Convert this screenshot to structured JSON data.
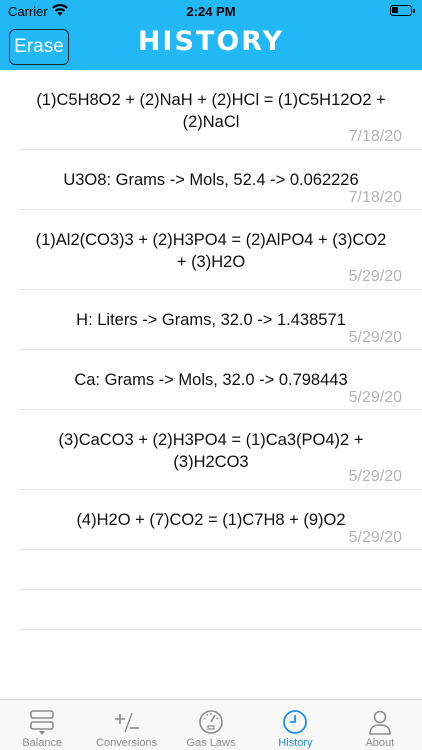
{
  "status_bar": {
    "carrier": "Carrier",
    "time": "2:24 PM"
  },
  "header": {
    "erase_label": "Erase",
    "title": "HISTORY"
  },
  "history": [
    {
      "line1": "(1)C5H8O2 + (2)NaH + (2)HCl = (1)C5H12O2 +",
      "line2": "(2)NaCl",
      "date": "7/18/20"
    },
    {
      "line1": "U3O8: Grams -> Mols, 52.4 -> 0.062226",
      "line2": "",
      "date": "7/18/20"
    },
    {
      "line1": "(1)Al2(CO3)3 + (2)H3PO4 = (2)AlPO4 + (3)CO2",
      "line2": "+ (3)H2O",
      "date": "5/29/20"
    },
    {
      "line1": "H: Liters -> Grams, 32.0 -> 1.438571",
      "line2": "",
      "date": "5/29/20"
    },
    {
      "line1": "Ca: Grams -> Mols, 32.0 -> 0.798443",
      "line2": "",
      "date": "5/29/20"
    },
    {
      "line1": "(3)CaCO3 + (2)H3PO4 = (1)Ca3(PO4)2 +",
      "line2": "(3)H2CO3",
      "date": "5/29/20"
    },
    {
      "line1": "(4)H2O + (7)CO2 = (1)C7H8 + (9)O2",
      "line2": "",
      "date": "5/29/20"
    }
  ],
  "tabs": [
    {
      "label": "Balance",
      "icon": "balance-icon"
    },
    {
      "label": "Conversions",
      "icon": "plus-minus-icon"
    },
    {
      "label": "Gas Laws",
      "icon": "gauge-icon"
    },
    {
      "label": "History",
      "icon": "clock-icon",
      "active": true
    },
    {
      "label": "About",
      "icon": "person-icon"
    }
  ],
  "colors": {
    "header": "#22b7f5",
    "active_tab": "#1d8ef0",
    "inactive_tab": "#8c8c8c",
    "date": "#b4b4b4"
  }
}
